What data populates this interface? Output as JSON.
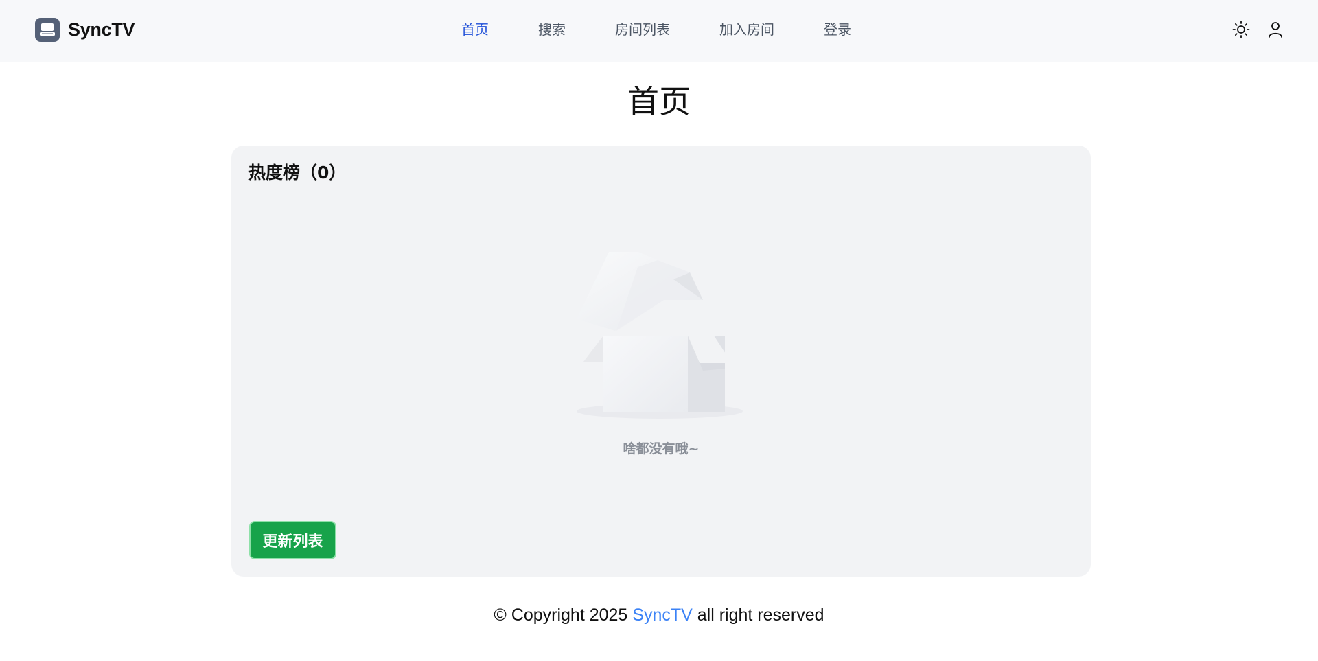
{
  "header": {
    "brand_name": "SyncTV",
    "nav": [
      {
        "label": "首页",
        "active": true
      },
      {
        "label": "搜索",
        "active": false
      },
      {
        "label": "房间列表",
        "active": false
      },
      {
        "label": "加入房间",
        "active": false
      },
      {
        "label": "登录",
        "active": false
      }
    ],
    "icons": {
      "logo": "tv-icon",
      "theme": "sun-icon",
      "user": "user-icon"
    }
  },
  "main": {
    "page_title": "首页",
    "hot_list": {
      "title": "热度榜（0）",
      "empty_text": "啥都没有哦~",
      "illustration": "empty-box-icon",
      "refresh_label": "更新列表"
    }
  },
  "footer": {
    "prefix": "© Copyright 2025",
    "link_text": "SyncTV",
    "suffix": "all right reserved"
  },
  "colors": {
    "accent": "#1d4ed8",
    "link": "#3b82f6",
    "success": "#17a34a",
    "header_bg": "#f7f8fa",
    "card_bg": "#f2f3f5"
  }
}
